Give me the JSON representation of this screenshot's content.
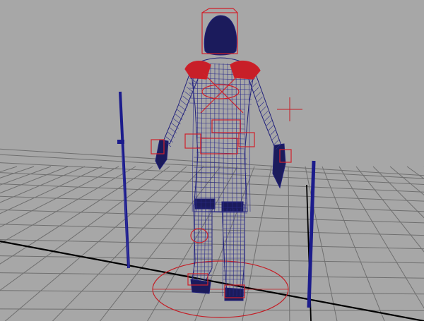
{
  "viewport": {
    "background": "#a7a7a7",
    "grid_color": "#6f6f6f",
    "axis_color": "#000000"
  },
  "scene": {
    "mesh_color": "#1f1f7a",
    "rig_color": "#d0202a",
    "objects": [
      {
        "name": "character-mesh"
      },
      {
        "name": "left-pole"
      },
      {
        "name": "right-pole"
      },
      {
        "name": "control-circle"
      },
      {
        "name": "locator"
      }
    ]
  }
}
